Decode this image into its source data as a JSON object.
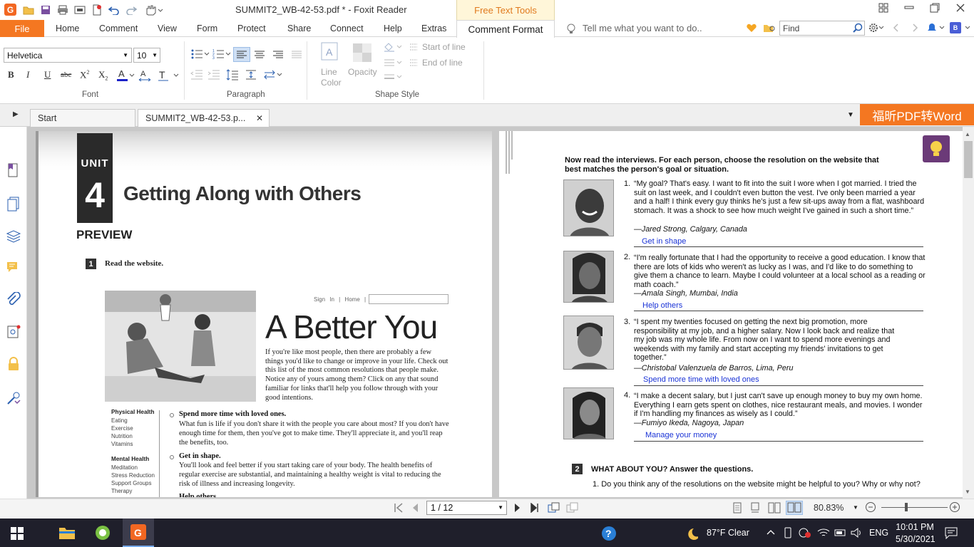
{
  "window": {
    "title": "SUMMIT2_WB-42-53.pdf * - Foxit Reader",
    "context_tab_group": "Free Text Tools"
  },
  "ribbon_tabs": {
    "file": "File",
    "home": "Home",
    "comment": "Comment",
    "view": "View",
    "form": "Form",
    "protect": "Protect",
    "share": "Share",
    "connect": "Connect",
    "help": "Help",
    "extras": "Extras",
    "comment_format": "Comment Format"
  },
  "tell_me": "Tell me what you want to do..",
  "find": {
    "placeholder": "Find"
  },
  "font_group": {
    "font_name": "Helvetica",
    "font_size": "10",
    "label": "Font"
  },
  "paragraph_group": {
    "label": "Paragraph"
  },
  "shape_group": {
    "line_color": "Line Color",
    "opacity": "Opacity",
    "start_of_line": "Start of line",
    "end_of_line": "End of line",
    "label": "Shape Style"
  },
  "doc_tabs": {
    "start": "Start",
    "current": "SUMMIT2_WB-42-53.p..."
  },
  "convert_button": "福昕PDF转Word",
  "left_page": {
    "unit_label": "UNIT",
    "unit_number": "4",
    "unit_title": "Getting Along with Others",
    "preview": "PREVIEW",
    "step1_num": "1",
    "step1_text": "Read the website.",
    "site_nav": "Sign In  |  Home  |",
    "site_title": "A Better You",
    "intro": "If you're like most people, then there are probably a few things you'd like to change or improve in your life. Check out this list of the most common resolutions that people make. Notice any of yours among them? Click on any that sound familiar for links that'll help you follow through with your good intentions.",
    "cat1_title": "Physical Health",
    "cat1_items": [
      "Eating",
      "Exercise",
      "Nutrition",
      "Vitamins"
    ],
    "cat2_title": "Mental Health",
    "cat2_items": [
      "Meditation",
      "Stress Reduction",
      "Support Groups",
      "Therapy"
    ],
    "res1_title": "Spend more time with loved ones.",
    "res1_body": "What fun is life if you don't share it with the people you care about most? If you don't have enough time for them, then you've got to make time. They'll appreciate it, and you'll reap the benefits, too.",
    "res2_title": "Get in shape.",
    "res2_body": "You'll look and feel better if you start taking care of your body. The health benefits of regular exercise are substantial, and maintaining a healthy weight is vital to reducing the risk of illness and increasing longevity.",
    "res3_title": "Help others."
  },
  "right_page": {
    "instructions": "Now read the interviews. For each person, choose the resolution on the website that best matches the person's goal or situation.",
    "items": [
      {
        "num": "1.",
        "quote": "“My goal? That's easy. I want to fit into the suit I wore when I got married. I tried the suit on last week, and I couldn't even button the vest. I've only been married a year and a half! I think every guy thinks he's just a few sit-ups away from a flat, washboard stomach. It was a shock to see how much weight I've gained in such a short time.”",
        "attribution": "—Jared Strong, Calgary, Canada",
        "answer": "Get in shape"
      },
      {
        "num": "2.",
        "quote": "“I'm really fortunate that I had the opportunity to receive a good education. I know that there are lots of kids who weren't as lucky as I was, and I'd like to do something to give them a chance to learn. Maybe I could volunteer at a local school as a reading or math coach.”",
        "attribution": "—Amala Singh, Mumbai, India",
        "answer": "Help others"
      },
      {
        "num": "3.",
        "quote": "“I spent my twenties focused on getting the next big promotion, more responsibility at my job, and a higher salary. Now I look back and realize that my job was my whole life. From now on I want to spend more evenings and weekends with my family and start accepting my friends' invitations to get together.”",
        "attribution": "—Christobal Valenzuela de Barros, Lima, Peru",
        "answer": "Spend more time with loved ones"
      },
      {
        "num": "4.",
        "quote": "“I make a decent salary, but I just can't save up enough money to buy my own home. Everything I earn gets spent on clothes, nice restaurant meals, and movies. I wonder if I'm handling my finances as wisely as I could.”",
        "attribution": "—Fumiyo Ikeda, Nagoya, Japan",
        "answer": "Manage your money"
      }
    ],
    "step2_num": "2",
    "step2_text": "WHAT ABOUT YOU? Answer the questions.",
    "q1": "1.   Do you think any of the resolutions on the website might be helpful to you? Why or why not?"
  },
  "status": {
    "page": "1 / 12",
    "zoom": "80.83%"
  },
  "taskbar": {
    "weather": "87°F  Clear",
    "lang": "ENG",
    "time": "10:01 PM",
    "date": "5/30/2021"
  },
  "colors": {
    "accent": "#f47721",
    "answer_text": "#1a33d6",
    "bulb_bg": "#6b3a78"
  }
}
